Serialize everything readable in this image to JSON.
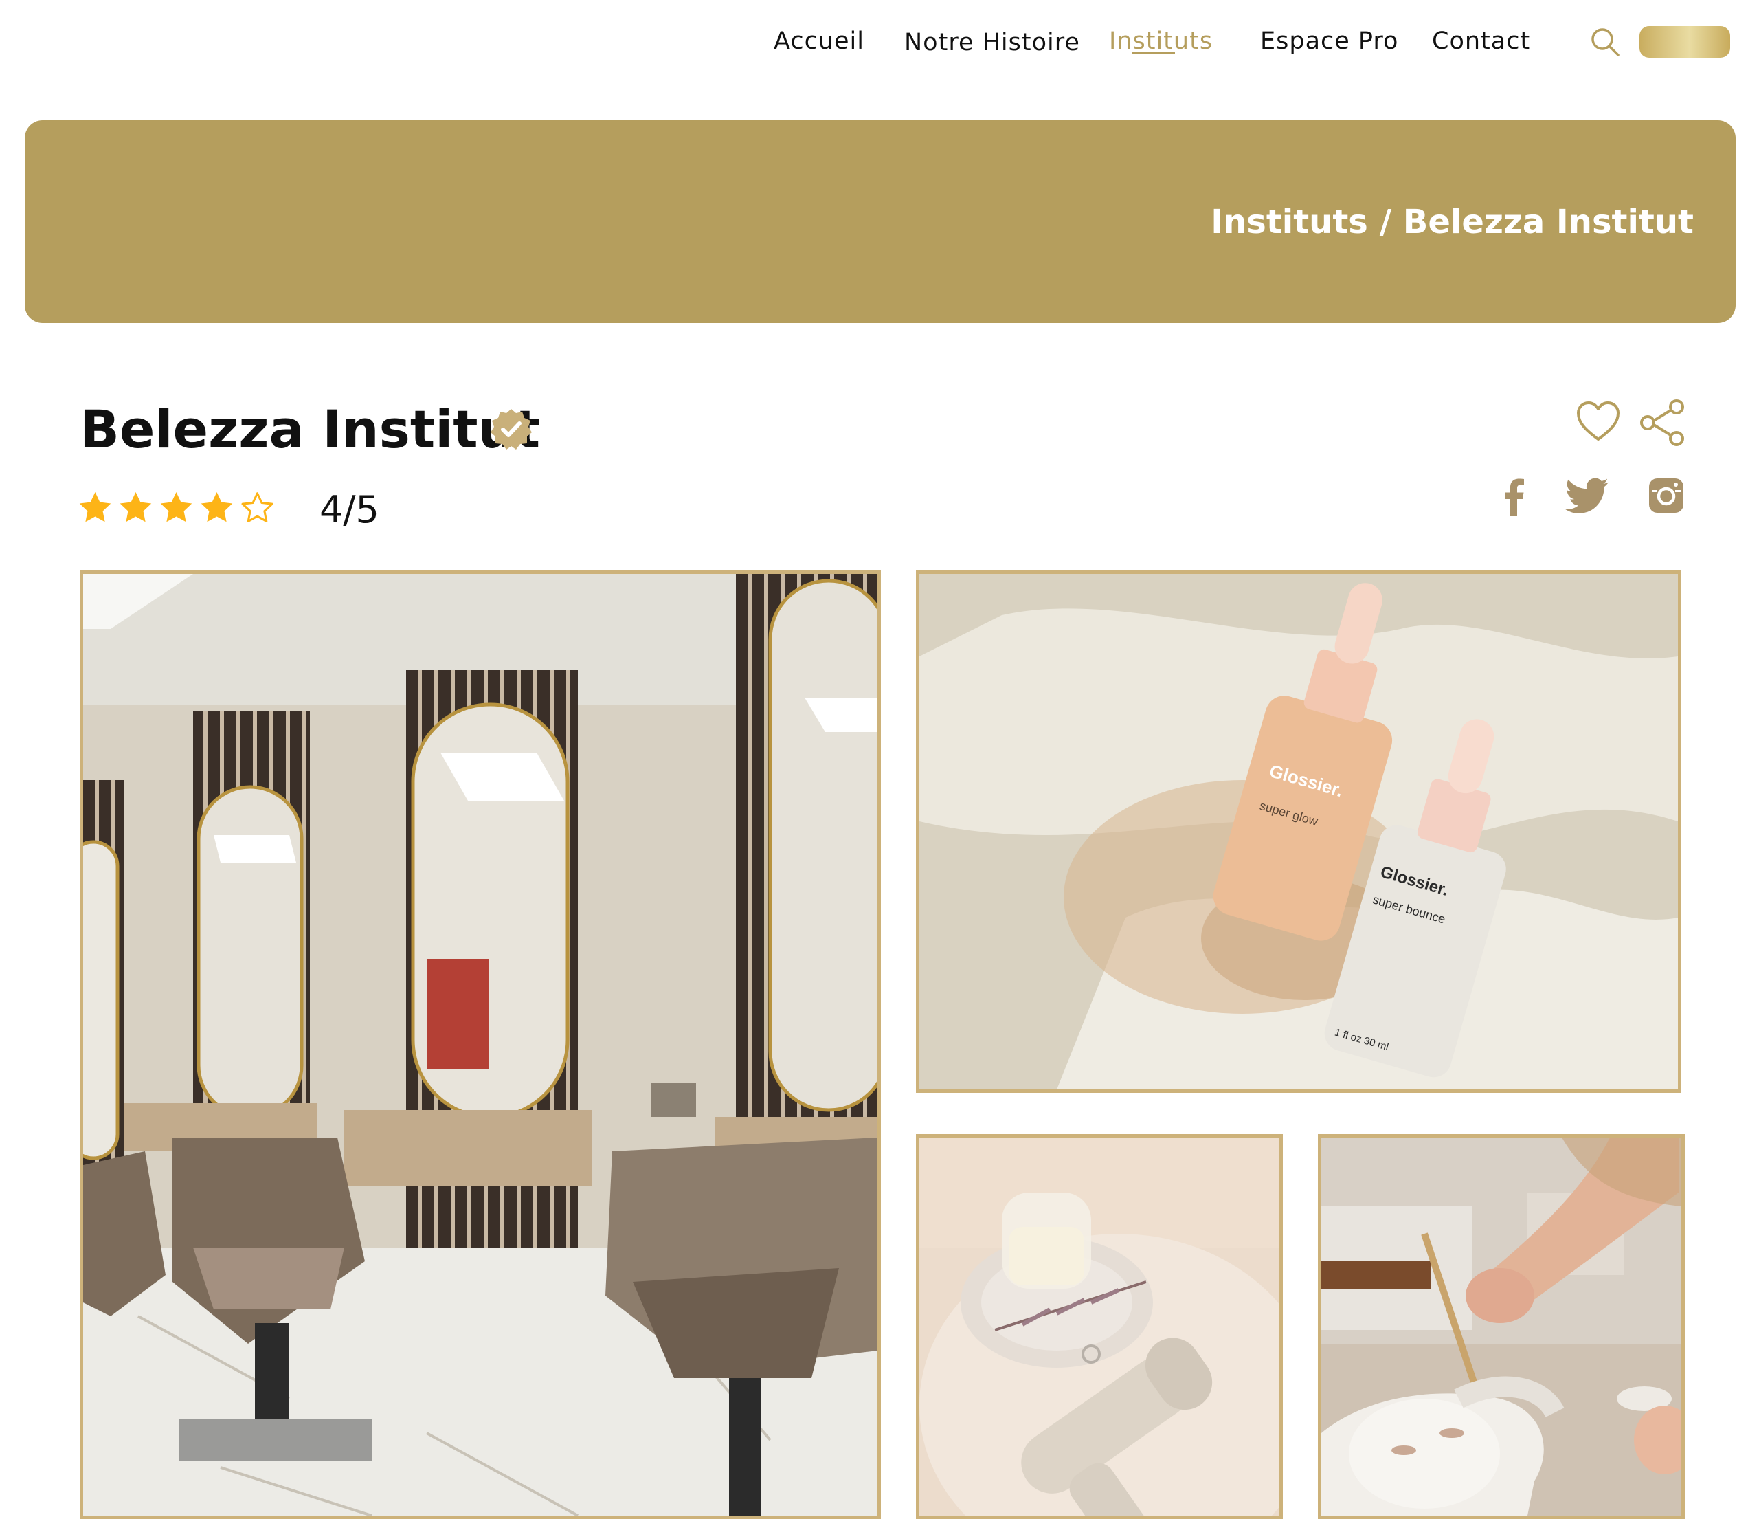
{
  "nav": {
    "items": [
      {
        "label": "Accueil"
      },
      {
        "label": "Notre Histoire"
      },
      {
        "label": "Instituts"
      },
      {
        "label": "Espace Pro"
      },
      {
        "label": "Contact"
      }
    ],
    "active": "Instituts",
    "icons": [
      "search-icon"
    ]
  },
  "banner": {
    "breadcrumb": "Instituts / Belezza Institut"
  },
  "institute": {
    "name": "Belezza Institut",
    "verified": true,
    "rating": 4,
    "rating_max": 5,
    "rating_text": "4/5"
  },
  "actions": {
    "icons": [
      "heart-icon",
      "share-icon"
    ]
  },
  "social": {
    "icons": [
      "facebook-icon",
      "twitter-icon",
      "instagram-icon"
    ]
  },
  "gallery": {
    "photos": [
      {
        "subject": "salon-interior"
      },
      {
        "subject": "serum-bottles",
        "brand": "Glossier.",
        "products": [
          "super glow",
          "super bounce"
        ],
        "volume": "1 fl oz 30 ml"
      },
      {
        "subject": "candle-and-dryer"
      },
      {
        "subject": "facial-treatment"
      }
    ]
  },
  "colors": {
    "accent": "#B59E5D",
    "frame": "#CDB27A",
    "star": "#FDB417",
    "text": "#111111"
  }
}
